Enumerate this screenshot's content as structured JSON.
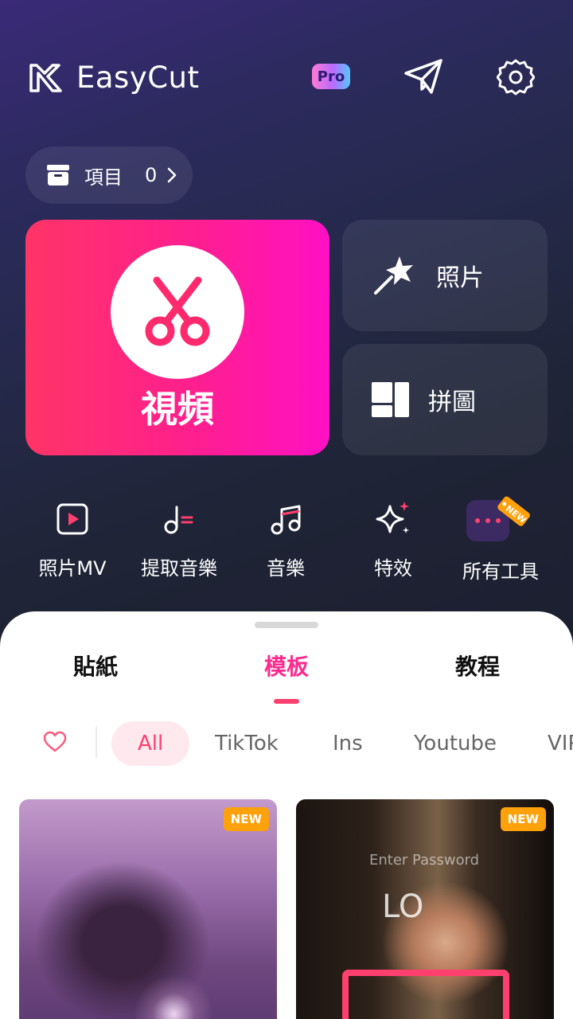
{
  "header": {
    "app_name": "EasyCut",
    "pro_badge": "Pro"
  },
  "project": {
    "label": "項目",
    "count": "0"
  },
  "main_cards": {
    "video": "視頻",
    "photo": "照片",
    "collage": "拼圖"
  },
  "tools": [
    {
      "label": "照片MV",
      "icon": "play-square-icon"
    },
    {
      "label": "提取音樂",
      "icon": "music-extract-icon"
    },
    {
      "label": "音樂",
      "icon": "music-note-icon"
    },
    {
      "label": "特效",
      "icon": "sparkle-icon"
    },
    {
      "label": "所有工具",
      "icon": "more-dots-icon",
      "badge": "NEW"
    }
  ],
  "tabs": [
    {
      "label": "貼紙",
      "active": false
    },
    {
      "label": "模板",
      "active": true
    },
    {
      "label": "教程",
      "active": false
    }
  ],
  "filters": [
    "All",
    "TikTok",
    "Ins",
    "Youtube",
    "VIP"
  ],
  "templates": [
    {
      "badge": "NEW"
    },
    {
      "badge": "NEW",
      "overlay_text": "Enter Password",
      "overlay_big": "LO"
    }
  ],
  "colors": {
    "accent": "#ff2a8e",
    "video_gradient_start": "#ff3466",
    "video_gradient_end": "#ff10c4",
    "new_badge": "#ffa10a"
  }
}
